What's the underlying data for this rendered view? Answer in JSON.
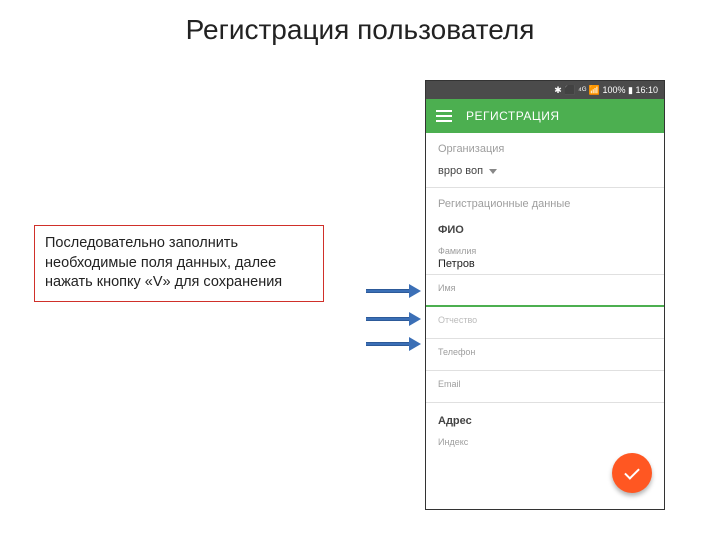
{
  "slide": {
    "title": "Регистрация пользователя",
    "note": "Последовательно заполнить необходимые поля данных, далее нажать кнопку «V» для сохранения"
  },
  "status_bar": {
    "icons_text": "✱ ⬛ ⁴ᴳ 📶 100% ▮ 16:10"
  },
  "app_bar": {
    "title": "РЕГИСТРАЦИЯ"
  },
  "sections": {
    "org_label": "Организация",
    "org_value": "врро воп",
    "reg_label": "Регистрационные данные",
    "fio_header": "ФИО",
    "familia_label": "Фамилия",
    "familia_value": "Петров",
    "imya_label": "Имя",
    "imya_value": "",
    "otchestvo_label": "Отчество",
    "otchestvo_value": "",
    "telefon_label": "Телефон",
    "telefon_value": "",
    "email_label": "Email",
    "email_value": "",
    "adres_header": "Адрес",
    "index_label": "Индекс"
  }
}
